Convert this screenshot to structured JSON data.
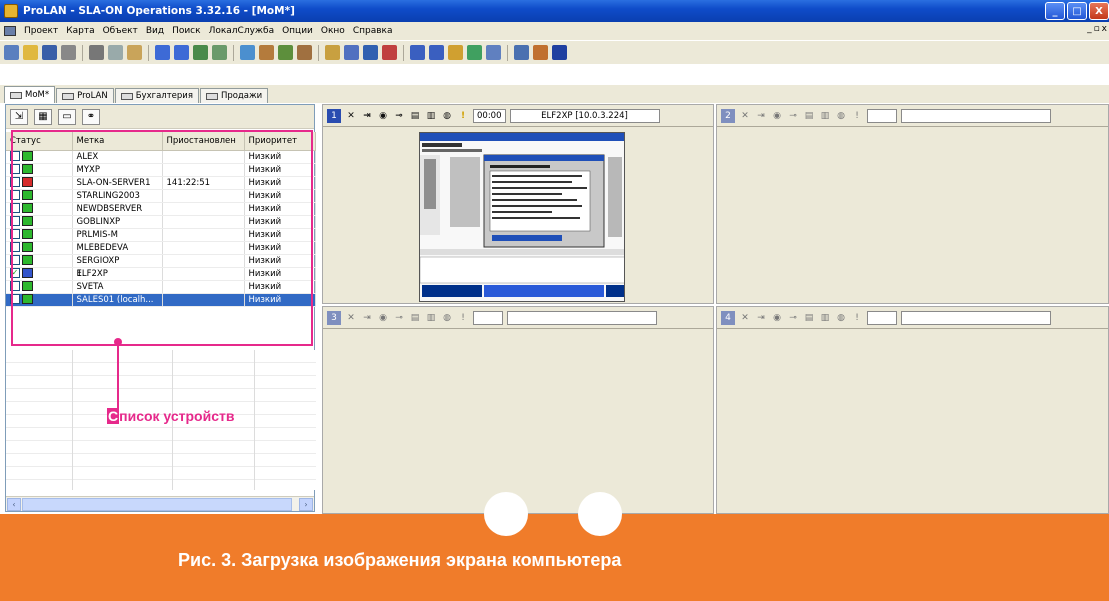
{
  "window": {
    "title": "ProLAN - SLA-ON Operations 3.32.16 - [MoM*]",
    "controls": {
      "minimize": "_",
      "maximize": "□",
      "close": "X"
    }
  },
  "menubar": {
    "items": [
      "Проект",
      "Карта",
      "Объект",
      "Вид",
      "Поиск",
      "ЛокалСлужба",
      "Опции",
      "Окно",
      "Справка"
    ],
    "mdi_controls": [
      "_",
      "▫",
      "x"
    ]
  },
  "toolbar": {
    "icons": [
      "new-icon",
      "open-icon",
      "save-icon",
      "pointer-icon",
      "cut-icon",
      "copy-icon",
      "paste-icon",
      "back-icon",
      "up-icon",
      "refresh-icon",
      "grid-icon",
      "map-icon",
      "user-icon",
      "chart-icon",
      "tools-icon",
      "help-icon"
    ]
  },
  "tabs": [
    "MoM*",
    "ProLAN",
    "Бухгалтерия",
    "Продажи"
  ],
  "device_list": {
    "headers": [
      "Статус",
      "Метка",
      "Приостановлен",
      "Приоритет"
    ],
    "rows": [
      {
        "check": "",
        "monitor": "green",
        "num": "",
        "label": "ALEX",
        "suspended": "",
        "priority": "Низкий"
      },
      {
        "check": "",
        "monitor": "green",
        "num": "",
        "label": "MYXP",
        "suspended": "",
        "priority": "Низкий"
      },
      {
        "check": "",
        "monitor": "red",
        "num": "",
        "label": "SLA-ON-SERVER1",
        "suspended": "141:22:51",
        "priority": "Низкий"
      },
      {
        "check": "",
        "monitor": "green",
        "num": "",
        "label": "STARLING2003",
        "suspended": "",
        "priority": "Низкий"
      },
      {
        "check": "",
        "monitor": "green",
        "num": "",
        "label": "NEWDBSERVER",
        "suspended": "",
        "priority": "Низкий"
      },
      {
        "check": "",
        "monitor": "green",
        "num": "",
        "label": "GOBLINXP",
        "suspended": "",
        "priority": "Низкий"
      },
      {
        "check": "",
        "monitor": "green",
        "num": "",
        "label": "PRLMIS-M",
        "suspended": "",
        "priority": "Низкий"
      },
      {
        "check": "",
        "monitor": "green",
        "num": "",
        "label": "MLEBEDEVA",
        "suspended": "",
        "priority": "Низкий"
      },
      {
        "check": "",
        "monitor": "green",
        "num": "",
        "label": "SERGIOXP",
        "suspended": "",
        "priority": "Низкий"
      },
      {
        "check": "✓",
        "monitor": "blue",
        "num": "1.",
        "label": "ELF2XP",
        "suspended": "",
        "priority": "Низкий"
      },
      {
        "check": "",
        "monitor": "green",
        "num": "",
        "label": "SVETA",
        "suspended": "",
        "priority": "Низкий"
      },
      {
        "check": "",
        "monitor": "green",
        "num": "",
        "label": "SALES01 (localh...",
        "suspended": "",
        "priority": "Низкий",
        "selected": true
      }
    ]
  },
  "annotation": {
    "label_first": "С",
    "label_rest": "писок устройств"
  },
  "panes": [
    {
      "num": "1",
      "time": "00:00",
      "address": "ELF2XP [10.0.3.224]"
    },
    {
      "num": "2",
      "time": "",
      "address": ""
    },
    {
      "num": "3",
      "time": "",
      "address": ""
    },
    {
      "num": "4",
      "time": "",
      "address": ""
    }
  ],
  "pane_icons": [
    "close-icon",
    "pin-icon",
    "zoom-icon",
    "key-icon",
    "screen-icon",
    "chart-icon",
    "refresh-icon",
    "alert-icon"
  ],
  "caption": "Рис. 3. Загрузка изображения экрана компьютера",
  "colors": {
    "accent": "#e6298b",
    "caption_bg": "#f07c2a",
    "titlebar": "#0f4cc9",
    "selection": "#316ac5"
  }
}
